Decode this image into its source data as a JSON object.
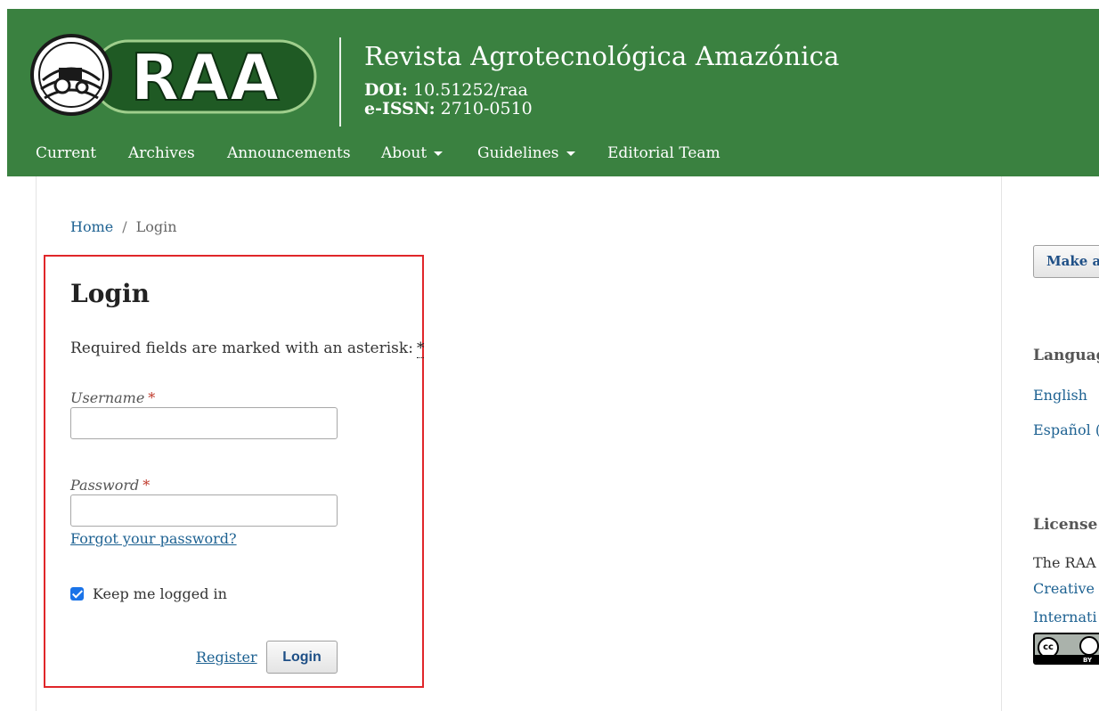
{
  "header": {
    "logo_text": "RAA",
    "title": "Revista Agrotecnológica Amazónica",
    "doi_label": "DOI:",
    "doi_value": "10.51252/raa",
    "issn_label": "e-ISSN:",
    "issn_value": "2710-0510",
    "colors": {
      "header_bg": "#3a8140",
      "logo_dark": "#1f5a24"
    }
  },
  "nav": {
    "items": [
      {
        "label": "Current"
      },
      {
        "label": "Archives"
      },
      {
        "label": "Announcements"
      },
      {
        "label": "About",
        "icon": "caret-down-icon"
      },
      {
        "label": "Guidelines",
        "icon": "caret-down-icon"
      },
      {
        "label": "Editorial Team"
      }
    ]
  },
  "breadcrumb": {
    "home": "Home",
    "separator": "/",
    "current": "Login"
  },
  "login": {
    "title": "Login",
    "required_note": "Required fields are marked with an asterisk:",
    "required_mark": "*",
    "username_label": "Username",
    "username_value": "",
    "password_label": "Password",
    "password_value": "",
    "forgot_link": "Forgot your password?",
    "remember_label": "Keep me logged in",
    "remember_checked": true,
    "register_link": "Register",
    "login_button": "Login"
  },
  "sidebar": {
    "button_label": "Make a",
    "language_heading": "Languag",
    "languages": [
      "English",
      "Español ("
    ],
    "license_heading": "License",
    "license_text": "The RAA",
    "license_links": [
      "Creative",
      "Internati"
    ],
    "license_badge_icon": "cc-by-license-icon",
    "badge_text": "BY"
  }
}
